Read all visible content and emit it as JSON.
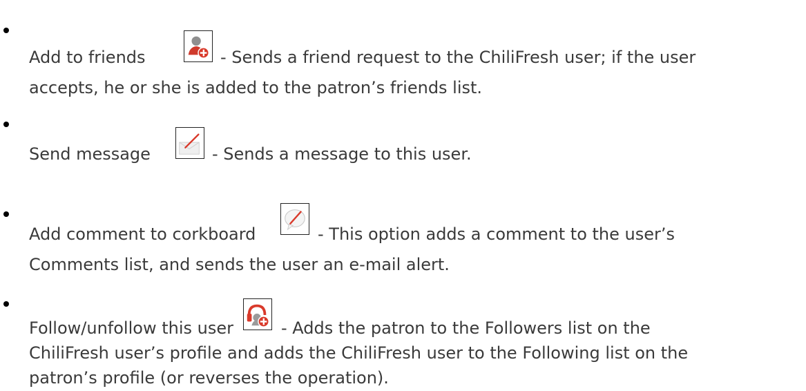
{
  "items": [
    {
      "title": "Add to friends",
      "icon": "add-friend-icon",
      "line1": "- Sends a friend request to the ChiliFresh user; if the user",
      "line2": "accepts, he or she is added to the patron’s friends list."
    },
    {
      "title": "Send message",
      "icon": "send-message-icon",
      "line1": "- Sends a message to this user."
    },
    {
      "title": "Add comment to corkboard",
      "icon": "comment-icon",
      "line1": "- This option adds a comment to the user’s",
      "line2": "Comments list, and sends the user an e-mail alert."
    },
    {
      "title": "Follow/unfollow this user",
      "icon": "follow-icon",
      "line1": "- Adds the patron to the Followers list on the",
      "line2": "ChiliFresh user’s profile and adds the ChiliFresh user to the Following list on the",
      "line3": "patron’s profile (or reverses the operation)."
    }
  ],
  "colors": {
    "text": "#3a3a3a",
    "accent_red": "#d93a2b",
    "icon_gray": "#9a9a9a"
  }
}
